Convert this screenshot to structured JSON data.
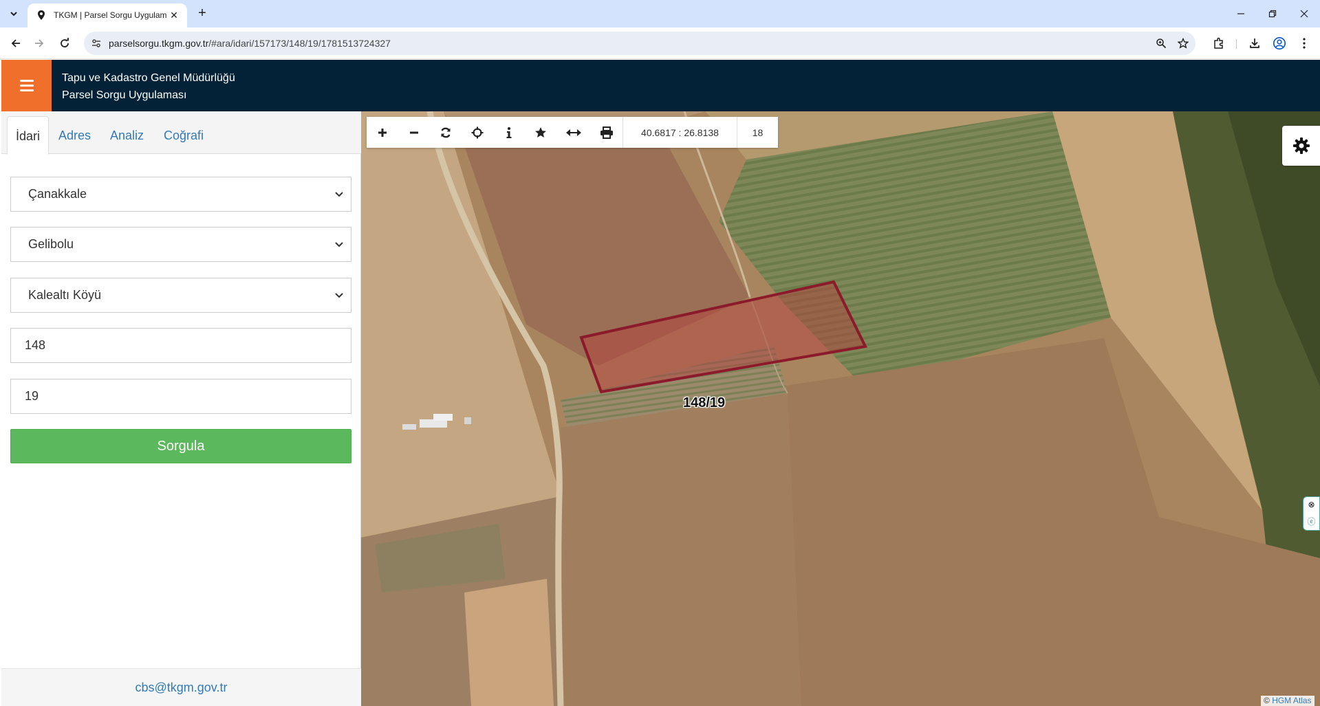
{
  "browser": {
    "tab_title": "TKGM | Parsel Sorgu Uygulama",
    "url_host": "parselsorgu.tkgm.gov.tr",
    "url_path": "/#ara/idari/157173/148/19/1781513724327"
  },
  "header": {
    "line1": "Tapu ve Kadastro Genel Müdürlüğü",
    "line2": "Parsel Sorgu Uygulaması"
  },
  "sidebar": {
    "tabs": [
      {
        "label": "İdari",
        "active": true
      },
      {
        "label": "Adres",
        "active": false
      },
      {
        "label": "Analiz",
        "active": false
      },
      {
        "label": "Coğrafi",
        "active": false
      }
    ],
    "province": "Çanakkale",
    "district": "Gelibolu",
    "neighborhood": "Kalealtı Köyü",
    "block": "148",
    "parcel": "19",
    "submit_label": "Sorgula",
    "footer_email": "cbs@tkgm.gov.tr"
  },
  "map": {
    "coords": "40.6817 : 26.8138",
    "zoom": "18",
    "parcel_label": "148/19",
    "attribution_prefix": "©",
    "attribution_link": "HGM Atlas",
    "parcel_color": "#8b1a2b"
  }
}
